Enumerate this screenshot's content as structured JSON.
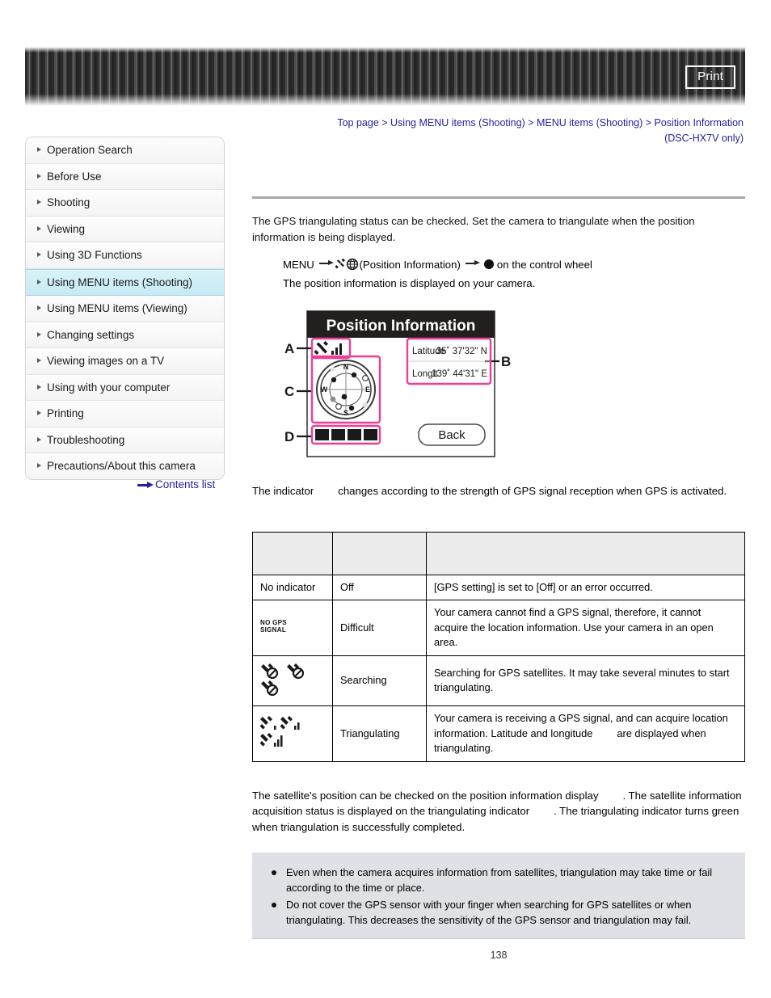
{
  "header": {
    "print_label": "Print"
  },
  "breadcrumb": {
    "line1": "Top page > Using MENU items (Shooting) > MENU items (Shooting) > Position Information",
    "line2": "(DSC-HX7V only)"
  },
  "sidebar": {
    "items": [
      {
        "label": "Operation Search",
        "active": false
      },
      {
        "label": "Before Use",
        "active": false
      },
      {
        "label": "Shooting",
        "active": false
      },
      {
        "label": "Viewing",
        "active": false
      },
      {
        "label": "Using 3D Functions",
        "active": false
      },
      {
        "label": "Using MENU items (Shooting)",
        "active": true
      },
      {
        "label": "Using MENU items (Viewing)",
        "active": false
      },
      {
        "label": "Changing settings",
        "active": false
      },
      {
        "label": "Viewing images on a TV",
        "active": false
      },
      {
        "label": "Using with your computer",
        "active": false
      },
      {
        "label": "Printing",
        "active": false
      },
      {
        "label": "Troubleshooting",
        "active": false
      },
      {
        "label": "Precautions/About this camera",
        "active": false
      }
    ],
    "contents_list_label": "Contents list"
  },
  "main": {
    "intro": "The GPS triangulating status can be checked. Set the camera to triangulate when the position information is being displayed.",
    "menu_step_prefix": "MENU",
    "menu_step_item": "(Position Information)",
    "menu_step_suffix": "on the control wheel",
    "menu_step_note": "The position information is displayed on your camera.",
    "indicator_para_before": "The indicator",
    "indicator_para_after": "changes according to the strength of GPS signal reception when GPS is activated.",
    "bottom_para_1": "The satellite's position can be checked on the position information display",
    "bottom_para_2": ". The satellite information acquisition status is displayed on the triangulating indicator",
    "bottom_para_3": ". The triangulating indicator turns green when triangulation is successfully completed."
  },
  "figure": {
    "title": "Position Information",
    "callout_a": "A",
    "callout_b": "B",
    "callout_c": "C",
    "callout_d": "D",
    "latitude_label": "Latitude",
    "latitude_value": "35˚ 37'32\" N",
    "longitude_label": "Longit.",
    "longitude_value": "139˚ 44'31\" E",
    "back_button": "Back",
    "compass_n": "N",
    "compass_s": "S",
    "compass_e": "E",
    "compass_w": "W"
  },
  "table": {
    "headers": [
      "",
      "",
      ""
    ],
    "rows": [
      {
        "icon": "no-indicator",
        "icon_text": "No indicator",
        "state": "Off",
        "description": "[GPS setting] is set to [Off] or an error occurred."
      },
      {
        "icon": "no-gps-signal",
        "icon_text": "NO GPS SIGNAL",
        "state": "Difficult",
        "description": "Your camera cannot find a GPS signal, therefore, it cannot acquire the location information. Use your camera in an open area."
      },
      {
        "icon": "gps-searching",
        "icon_text": "",
        "state": "Searching",
        "description": "Searching for GPS satellites. It may take several minutes to start triangulating."
      },
      {
        "icon": "gps-triangulating",
        "icon_text": "",
        "state": "Triangulating",
        "description_1": "Your camera is receiving a GPS signal, and can acquire location information. Latitude and longitude",
        "description_2": "are displayed when triangulating."
      }
    ]
  },
  "notes": {
    "items": [
      "Even when the camera acquires information from satellites, triangulation may take time or fail according to the time or place.",
      "Do not cover the GPS sensor with your finger when searching for GPS satellites or when triangulating. This decreases the sensitivity of the GPS sensor and triangulation may fail."
    ]
  },
  "footer": {
    "page_number": "138"
  },
  "colors": {
    "link": "#22229c",
    "sidebar_active": "#c7eaf4",
    "figure_accent": "#ee3d96",
    "note_bg": "#dfe1e6"
  }
}
